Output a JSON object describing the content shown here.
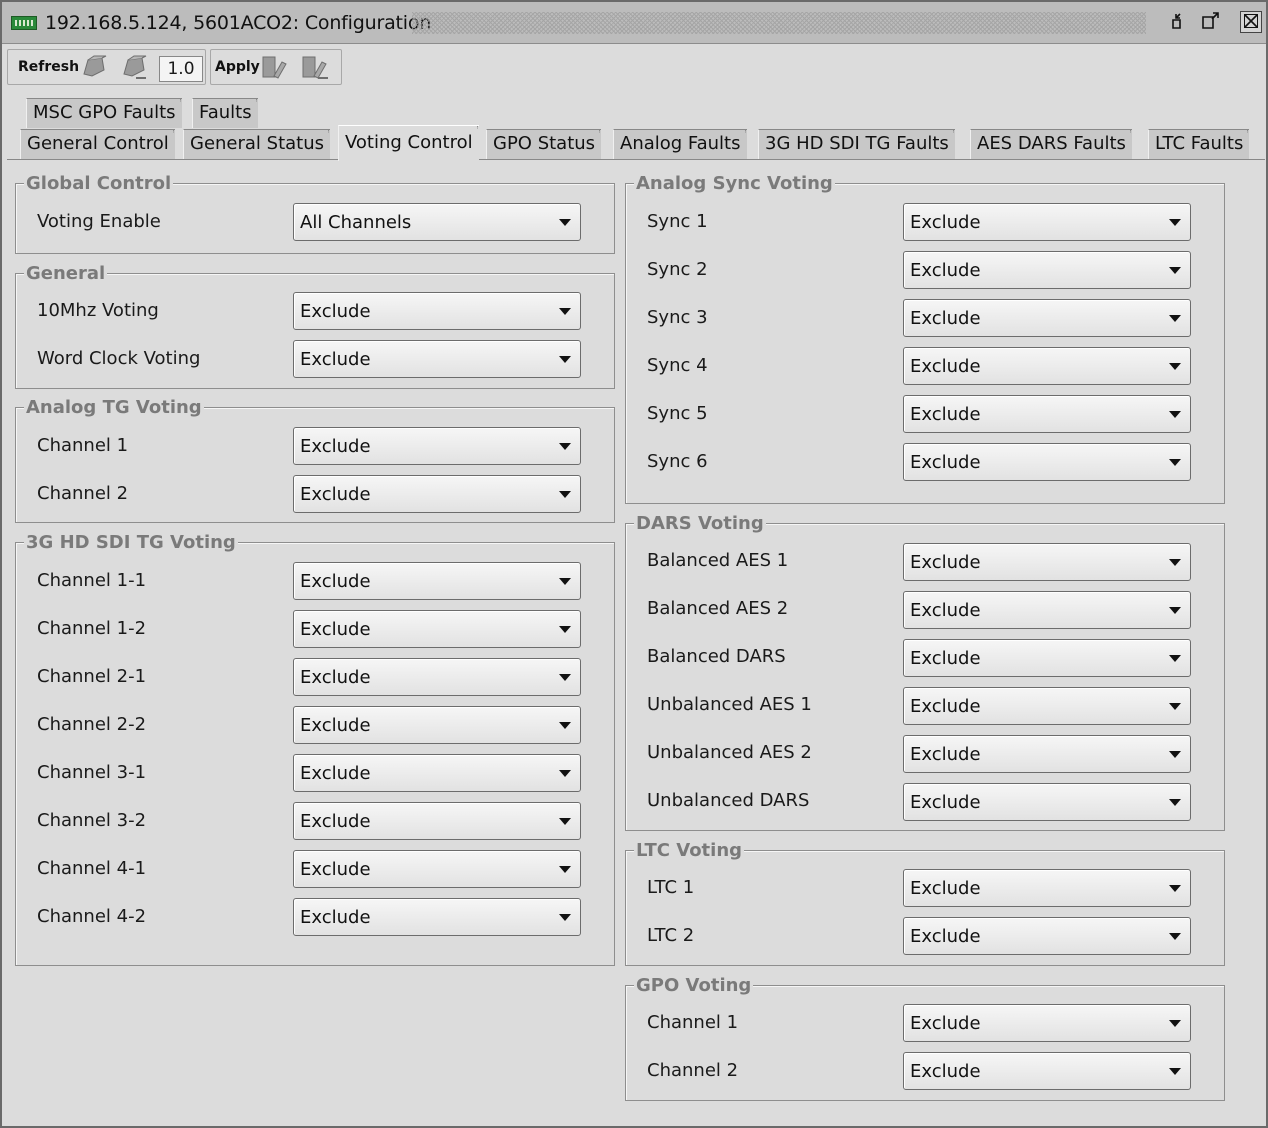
{
  "window": {
    "title": "192.168.5.124, 5601ACO2: Configuration",
    "icons": [
      "device-icon",
      "shrink-icon",
      "expand-icon",
      "close-icon"
    ]
  },
  "toolbar": {
    "refresh_label": "Refresh",
    "version_value": "1.0",
    "apply_label": "Apply"
  },
  "tabs": {
    "upper": [
      "MSC GPO Faults",
      "Faults"
    ],
    "lower": [
      "General Control",
      "General Status",
      "Voting Control",
      "GPO Status",
      "Analog Faults",
      "3G HD SDI TG Faults",
      "AES DARS Faults",
      "LTC Faults"
    ],
    "active": "Voting Control"
  },
  "global_control": {
    "title": "Global Control",
    "rows": [
      {
        "label": "Voting Enable",
        "value": "All Channels"
      }
    ]
  },
  "general": {
    "title": "General",
    "rows": [
      {
        "label": "10Mhz Voting",
        "value": "Exclude"
      },
      {
        "label": "Word Clock Voting",
        "value": "Exclude"
      }
    ]
  },
  "analog_tg_voting": {
    "title": "Analog TG Voting",
    "rows": [
      {
        "label": "Channel 1",
        "value": "Exclude"
      },
      {
        "label": "Channel 2",
        "value": "Exclude"
      }
    ]
  },
  "sdi_tg_voting": {
    "title": "3G HD SDI TG Voting",
    "rows": [
      {
        "label": "Channel 1-1",
        "value": "Exclude"
      },
      {
        "label": "Channel 1-2",
        "value": "Exclude"
      },
      {
        "label": "Channel 2-1",
        "value": "Exclude"
      },
      {
        "label": "Channel 2-2",
        "value": "Exclude"
      },
      {
        "label": "Channel 3-1",
        "value": "Exclude"
      },
      {
        "label": "Channel 3-2",
        "value": "Exclude"
      },
      {
        "label": "Channel 4-1",
        "value": "Exclude"
      },
      {
        "label": "Channel 4-2",
        "value": "Exclude"
      }
    ]
  },
  "analog_sync_voting": {
    "title": "Analog Sync Voting",
    "rows": [
      {
        "label": "Sync 1",
        "value": "Exclude"
      },
      {
        "label": "Sync 2",
        "value": "Exclude"
      },
      {
        "label": "Sync 3",
        "value": "Exclude"
      },
      {
        "label": "Sync 4",
        "value": "Exclude"
      },
      {
        "label": "Sync 5",
        "value": "Exclude"
      },
      {
        "label": "Sync 6",
        "value": "Exclude"
      }
    ]
  },
  "dars_voting": {
    "title": "DARS Voting",
    "rows": [
      {
        "label": "Balanced AES 1",
        "value": "Exclude"
      },
      {
        "label": "Balanced AES 2",
        "value": "Exclude"
      },
      {
        "label": "Balanced DARS",
        "value": "Exclude"
      },
      {
        "label": "Unbalanced AES 1",
        "value": "Exclude"
      },
      {
        "label": "Unbalanced AES 2",
        "value": "Exclude"
      },
      {
        "label": "Unbalanced DARS",
        "value": "Exclude"
      }
    ]
  },
  "ltc_voting": {
    "title": "LTC Voting",
    "rows": [
      {
        "label": "LTC 1",
        "value": "Exclude"
      },
      {
        "label": "LTC 2",
        "value": "Exclude"
      }
    ]
  },
  "gpo_voting": {
    "title": "GPO Voting",
    "rows": [
      {
        "label": "Channel 1",
        "value": "Exclude"
      },
      {
        "label": "Channel 2",
        "value": "Exclude"
      }
    ]
  }
}
